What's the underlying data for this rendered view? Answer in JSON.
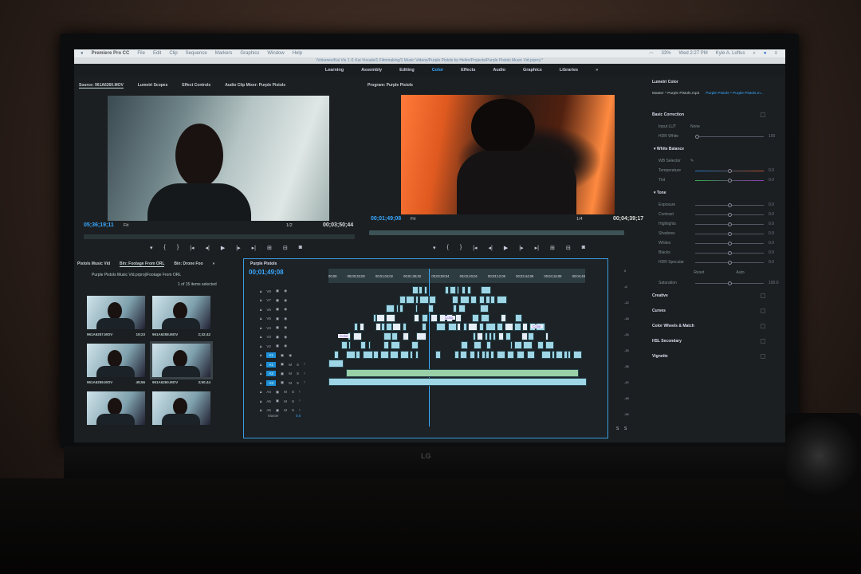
{
  "menubar": {
    "app": "Premiere Pro CC",
    "items": [
      "File",
      "Edit",
      "Clip",
      "Sequence",
      "Markers",
      "Graphics",
      "Window",
      "Help"
    ],
    "battery": "33%",
    "clock": "Wed 2:27 PM",
    "user": "Kyle A. Loftus"
  },
  "titlebar": "/Volumes/Kai Vis 1 /1 Kai Visuals/1 Filmmaking/1 Music Videos/Purple Pistols by Helim/Projects/Purple Pistols Music Vid.prproj *",
  "workspaces": [
    "Learning",
    "Assembly",
    "Editing",
    "Color",
    "Effects",
    "Audio",
    "Graphics",
    "Libraries",
    "»"
  ],
  "source": {
    "tabs": [
      "Source: 961A6260.MOV",
      "Lumetri Scopes",
      "Effect Controls",
      "Audio Clip Mixer: Purple Pistols"
    ],
    "timecode": "05;36;19;11",
    "fit": "Fit",
    "res": "1/2",
    "duration": "00;03;50;44"
  },
  "program": {
    "tab": "Program: Purple Pistols",
    "timecode": "00;01;49;08",
    "fit": "Fit",
    "res": "1/4",
    "duration": "00;04;39;17"
  },
  "controls": [
    "▾",
    "{",
    "}",
    "|◂",
    "◂|",
    "▶",
    "|▸",
    "▸|",
    "⊞",
    "⊟",
    "◙"
  ],
  "project": {
    "tabs": [
      "Pistols Music Vid",
      "Bin: Footage From ORL",
      "Bin: Drone Foo",
      "»"
    ],
    "path": "Purple Pistols Music Vid.prproj\\Footage From ORL",
    "count": "1 of 15 items selected",
    "items": [
      {
        "name": "961A6257.MOV",
        "dur": "19;23"
      },
      {
        "name": "961A6258.MOV",
        "dur": "2;32;42"
      },
      {
        "name": "961A6259.MOV",
        "dur": "49;56"
      },
      {
        "name": "961A6260.MOV",
        "dur": "3;50;44"
      },
      {
        "name": "",
        "dur": ""
      },
      {
        "name": "",
        "dur": ""
      }
    ]
  },
  "timeline": {
    "tab": "Purple Pistols",
    "timecode": "00;01;49;08",
    "ruler": [
      "00;00",
      "00;00;32;00",
      "00;01;04;02",
      "00;01;36;02",
      "00;02;08;04",
      "00;02;40;04",
      "00;03;12;06",
      "00;03;44;06",
      "00;04;16;08",
      "00;04;48"
    ],
    "video_tracks": [
      "V8",
      "V7",
      "V6",
      "V5",
      "V4",
      "V3",
      "V2",
      "V1"
    ],
    "audio_tracks": [
      "A1",
      "A2",
      "A3",
      "A4",
      "A5",
      "A6"
    ],
    "source_v": "V1",
    "source_a": "A1",
    "master": "Master",
    "master_val": "0.0",
    "clip_labels": [
      "Color",
      "Color",
      "Color"
    ]
  },
  "meter": [
    "0",
    "-6",
    "-12",
    "-18",
    "-24",
    "-30",
    "-36",
    "-42",
    "-48",
    "-54"
  ],
  "meter_solo": [
    "S",
    "S"
  ],
  "lumetri": {
    "title": "Lumetri Color",
    "master": "Master * Purple Pistols.mp3",
    "seq": "Purple Pistols * Purple Pistols.m...",
    "basic": "Basic Correction",
    "input_lut": "Input LUT",
    "lut_val": "None",
    "hdr_white": "HDR White",
    "hdr_val": "100",
    "wb": "White Balance",
    "wb_selector": "WB Selector",
    "tone": "Tone",
    "sliders": [
      {
        "label": "Temperature",
        "value": "0.0"
      },
      {
        "label": "Tint",
        "value": "0.0"
      },
      {
        "label": "Exposure",
        "value": "0.0"
      },
      {
        "label": "Contrast",
        "value": "0.0"
      },
      {
        "label": "Highlights",
        "value": "0.0"
      },
      {
        "label": "Shadows",
        "value": "0.0"
      },
      {
        "label": "Whites",
        "value": "0.0"
      },
      {
        "label": "Blacks",
        "value": "0.0"
      },
      {
        "label": "HDR Specular",
        "value": "0.0"
      }
    ],
    "reset": "Reset",
    "auto": "Auto",
    "saturation": "Saturation",
    "sat_val": "100.0",
    "sections": [
      "Creative",
      "Curves",
      "Color Wheels & Match",
      "HSL Secondary",
      "Vignette"
    ]
  },
  "monitor_logo": "LG",
  "colors": {
    "accent": "#3aa8ff",
    "timeline_border": "#3a9ce0"
  }
}
